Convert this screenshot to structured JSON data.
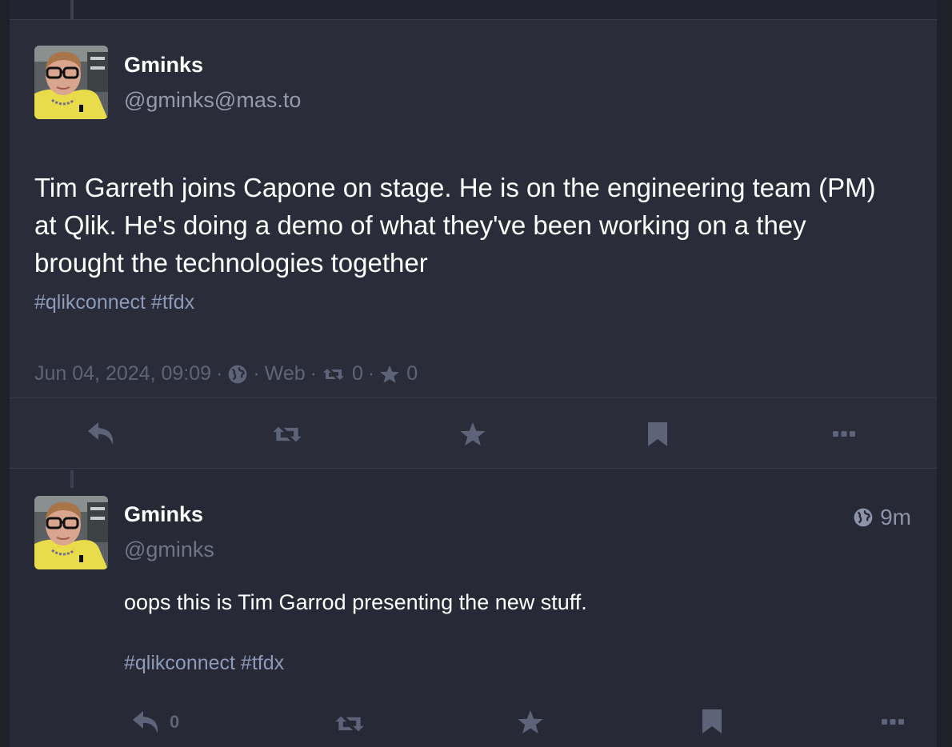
{
  "colors": {
    "background": "#272a36",
    "text": "#ffffff",
    "muted": "#9499ab",
    "hashtag": "#8d9ab8",
    "icon": "#5d6378",
    "avatar_shirt": "#e9dc4a"
  },
  "main_post": {
    "display_name": "Gminks",
    "acct": "@gminks@mas.to",
    "content": "Tim Garreth joins Capone on stage. He is on the engineering team (PM) at Qlik. He's doing a demo of what they've been working on a they brought the technologies together",
    "hashtags": "#qlikconnect #tfdx",
    "meta": {
      "date": "Jun 04, 2024, 09:09",
      "separator": "·",
      "visibility_icon": "globe-icon",
      "app": "Web",
      "boost_count": "0",
      "favourite_count": "0"
    },
    "actions": [
      {
        "name": "reply",
        "icon": "reply-icon"
      },
      {
        "name": "boost",
        "icon": "retweet-icon"
      },
      {
        "name": "favourite",
        "icon": "star-icon"
      },
      {
        "name": "bookmark",
        "icon": "bookmark-icon"
      },
      {
        "name": "more",
        "icon": "ellipsis-icon"
      }
    ]
  },
  "reply_post": {
    "display_name": "Gminks",
    "acct": "@gminks",
    "relative_time": "9m",
    "visibility_icon": "globe-icon",
    "content": "oops this is Tim Garrod presenting the new stuff.",
    "hashtags": "#qlikconnect #tfdx",
    "reply_count": "0"
  }
}
